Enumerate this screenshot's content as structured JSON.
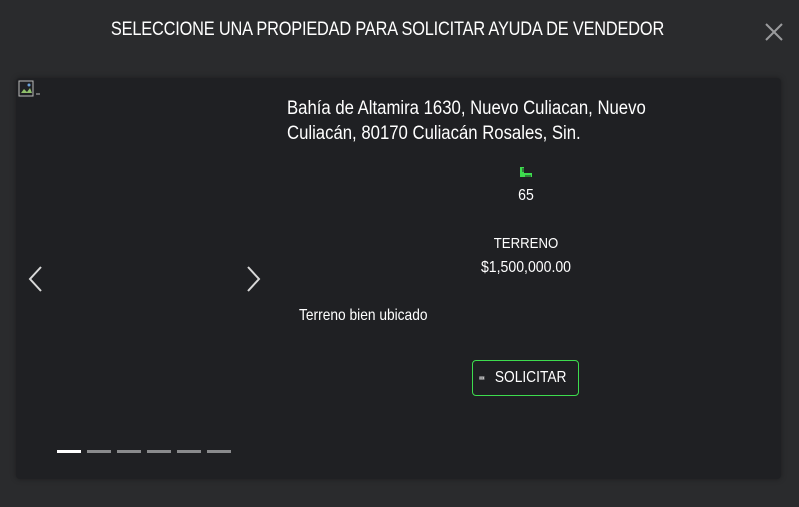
{
  "modal": {
    "title": "SELECCIONE UNA PROPIEDAD PARA SOLICITAR AYUDA DE VENDEDOR",
    "close_icon": "close-icon"
  },
  "property": {
    "address": "Bahía de Altamira 1630, Nuevo Culiacan, Nuevo Culiacán, 80170 Culiacán Rosales, Sin.",
    "area": "65",
    "area_icon": "ruler-area-icon",
    "type": "TERRENO",
    "price": "$1,500,000.00",
    "description": "Terreno bien ubicado",
    "button_label": "SOLICITAR",
    "button_icon": "ticket-icon"
  },
  "carousel": {
    "image_icon": "broken-image-icon",
    "prev_icon": "chevron-left-icon",
    "next_icon": "chevron-right-icon",
    "slide_count": 6,
    "active_slide": 1
  },
  "colors": {
    "background": "#2a2b2d",
    "card": "#1f2023",
    "accent_green": "#3ddc4e",
    "text": "#ffffff"
  }
}
